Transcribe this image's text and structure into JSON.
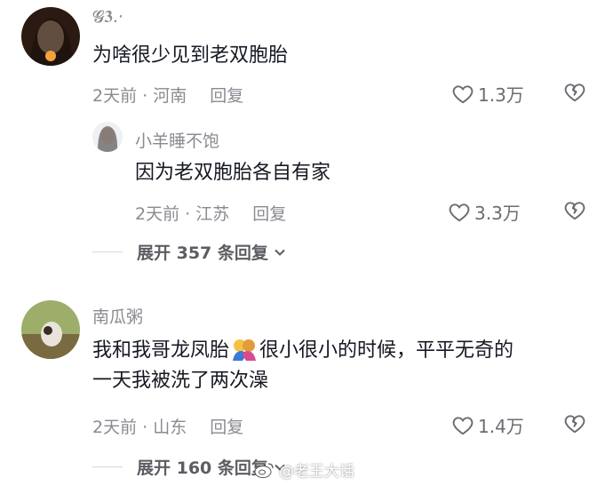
{
  "comments": [
    {
      "author": "𝓖𝟑.·",
      "text": "为啥很少见到老双胞胎",
      "time_location": "2天前 · 河南",
      "reply_label": "回复",
      "likes": "1.3万",
      "replies": [
        {
          "author": "小羊睡不饱",
          "text": "因为老双胞胎各自有家",
          "time_location": "2天前 · 江苏",
          "reply_label": "回复",
          "likes": "3.3万"
        }
      ],
      "expand_label": "展开 357 条回复"
    },
    {
      "author": "南瓜粥",
      "text_before_emoji": "我和我哥龙凤胎",
      "emoji": "people-hugging-emoji",
      "text_after_emoji": "很小很小的时候，平平无奇的",
      "text_line2": "一天我被洗了两次澡",
      "time_location": "2天前 · 山东",
      "reply_label": "回复",
      "likes": "1.4万",
      "expand_label": "展开 160 条回复"
    }
  ],
  "watermark": "@老王大话",
  "colors": {
    "primary_text": "#161823",
    "secondary_text": "#8a8b91",
    "background": "#ffffff"
  }
}
